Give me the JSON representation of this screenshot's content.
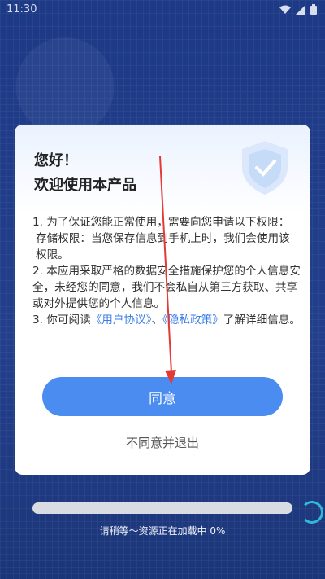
{
  "status_bar": {
    "time": "11:30"
  },
  "dialog": {
    "greeting_line1": "您好！",
    "greeting_line2": "欢迎使用本产品",
    "paragraph1": "1. 为了保证您能正常使用，需要向您申请以下权限：",
    "paragraph2": "存储权限：当您保存信息到手机上时，我们会使用该权限。",
    "paragraph3": "2. 本应用采取严格的数据安全措施保护您的个人信息安全，未经您的同意，我们不会私自从第三方获取、共享或对外提供您的个人信息。",
    "paragraph4_prefix": "3. 你可阅读",
    "user_agreement_link": "《用户协议》",
    "separator": "、",
    "privacy_policy_link": "《隐私政策》",
    "paragraph4_suffix": "了解详细信息。",
    "agree_button": "同意",
    "disagree_button": "不同意并退出"
  },
  "loading": {
    "text": "请稍等～资源正在加载中 0%",
    "progress": 0
  },
  "colors": {
    "accent": "#4a8cf0",
    "link": "#3a7de8",
    "background": "#1f3d8a",
    "annotation_arrow": "#e53935"
  },
  "icons": [
    "wifi-icon",
    "cell-signal-icon",
    "battery-icon",
    "shield-icon"
  ]
}
